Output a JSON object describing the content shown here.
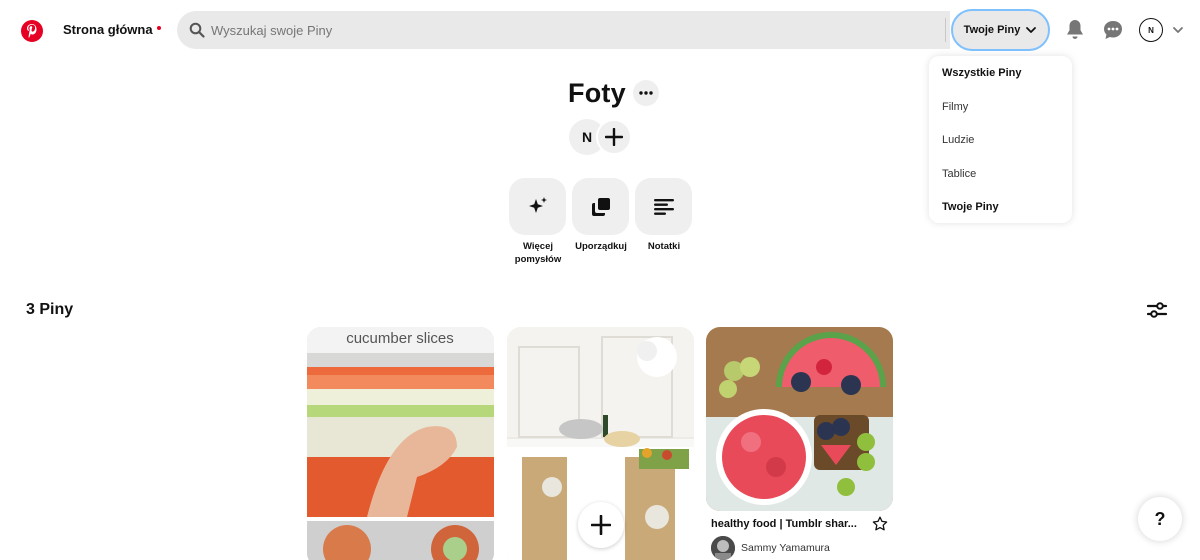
{
  "header": {
    "home_label": "Strona główna",
    "search_placeholder": "Wyszukaj swoje Piny",
    "scope_label": "Twoje Piny",
    "avatar_initial": "N"
  },
  "dropdown": {
    "items": [
      {
        "label": "Wszystkie Piny",
        "bold": true
      },
      {
        "label": "Filmy",
        "bold": false
      },
      {
        "label": "Ludzie",
        "bold": false
      },
      {
        "label": "Tablice",
        "bold": false
      },
      {
        "label": "Twoje Piny",
        "bold": true
      }
    ]
  },
  "board": {
    "title": "Foty",
    "owner_initial": "N",
    "actions": [
      {
        "label": "Więcej pomysłów",
        "icon": "sparkle-icon"
      },
      {
        "label": "Uporządkuj",
        "icon": "organize-icon"
      },
      {
        "label": "Notatki",
        "icon": "notes-icon"
      }
    ],
    "pins_count": "3 Piny"
  },
  "pins": [
    {
      "image_text": "cucumber slices",
      "title": "",
      "user": ""
    },
    {
      "image_text": "",
      "title": "",
      "user": ""
    },
    {
      "image_text": "",
      "title": "healthy food | Tumblr shar...",
      "user": "Sammy Yamamura"
    }
  ],
  "help_label": "?",
  "colors": {
    "brand": "#e60023",
    "search_bg": "#e9e9e9",
    "focus_ring": "#7fc1ff",
    "chip_bg": "#efefef"
  }
}
